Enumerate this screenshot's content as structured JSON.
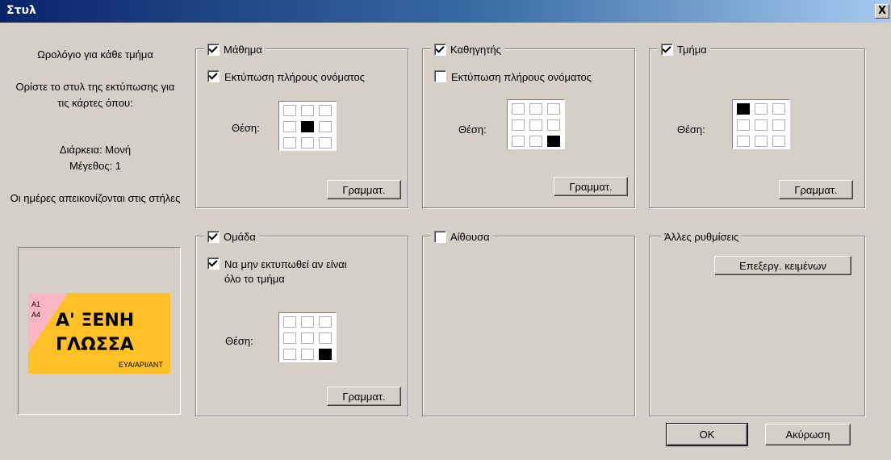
{
  "window": {
    "title": "Στυλ",
    "close_glyph": "X"
  },
  "info": {
    "line1": "Ωρολόγιο για κάθε τμήμα",
    "line2": "Ορίστε το στυλ της εκτύπωσης για τις κάρτες όπου:",
    "line3a": "Διάρκεια: Μονή",
    "line3b": "Μέγεθος: 1",
    "line4": "Οι ημέρες απεικονίζονται στις στήλες"
  },
  "preview": {
    "code1": "A1",
    "code2": "A4",
    "subject_line1": "Α' ΞΕΝΗ",
    "subject_line2": "ΓΛΩΣΣΑ",
    "code3": "ΕΥΑ/ΑΡΙ/ΑΝΤ",
    "colors": {
      "pink": "#f7b6c2",
      "yellow": "#ffc125"
    }
  },
  "groups": {
    "subject": {
      "label": "Μάθημα",
      "checked": true,
      "full_name_label": "Εκτύπωση πλήρους ονόματος",
      "full_name_checked": true,
      "position_label": "Θέση:",
      "position_cell": 4,
      "font_button": "Γραμματ."
    },
    "teacher": {
      "label": "Καθηγητής",
      "checked": true,
      "full_name_label": "Εκτύπωση πλήρους ονόματος",
      "full_name_checked": false,
      "position_label": "Θέση:",
      "position_cell": 8,
      "font_button": "Γραμματ."
    },
    "class": {
      "label": "Τμήμα",
      "checked": true,
      "position_label": "Θέση:",
      "position_cell": 0,
      "font_button": "Γραμματ."
    },
    "group": {
      "label": "Ομάδα",
      "checked": true,
      "hide_label_line1": "Να μην εκτυπωθεί αν είναι",
      "hide_label_line2": "όλο το τμήμα",
      "hide_checked": true,
      "position_label": "Θέση:",
      "position_cell": 8,
      "font_button": "Γραμματ."
    },
    "room": {
      "label": "Αίθουσα",
      "checked": false
    },
    "other": {
      "label": "Άλλες ρυθμίσεις",
      "edit_button": "Επεξεργ. κειμένων"
    }
  },
  "buttons": {
    "ok": "OK",
    "cancel": "Ακύρωση"
  }
}
